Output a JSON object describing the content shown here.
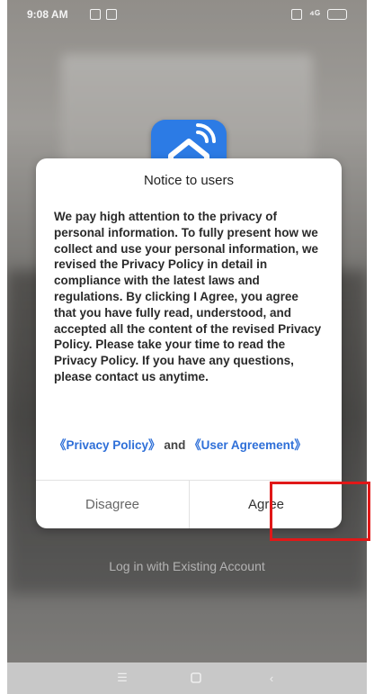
{
  "status_bar": {
    "time": "9:08 AM",
    "signal": "⁴ᴳ",
    "battery_icon": "battery-icon"
  },
  "app_icon": {
    "icon": "smart-home-icon",
    "color": "#2c7be5"
  },
  "dialog": {
    "title": "Notice to users",
    "body": "We pay high attention to the privacy of personal information. To fully present how we collect and use your personal information, we revised the Privacy Policy in detail in compliance with the latest laws and regulations. By clicking I Agree, you agree that you have fully read, understood, and accepted all the content of the revised Privacy Policy. Please take your time to read the Privacy Policy. If you have any questions, please contact us anytime.",
    "privacy_policy_link": "《Privacy Policy》",
    "and_text": "and",
    "user_agreement_link": "《User Agreement》",
    "disagree_label": "Disagree",
    "agree_label": "Agree"
  },
  "login_existing_label": "Log in with Existing Account",
  "nav_bar": {
    "menu_icon": "menu-icon",
    "home_icon": "home-icon",
    "back_icon": "back-icon"
  },
  "colors": {
    "highlight": "#e01818",
    "link": "#2e6fd8"
  }
}
